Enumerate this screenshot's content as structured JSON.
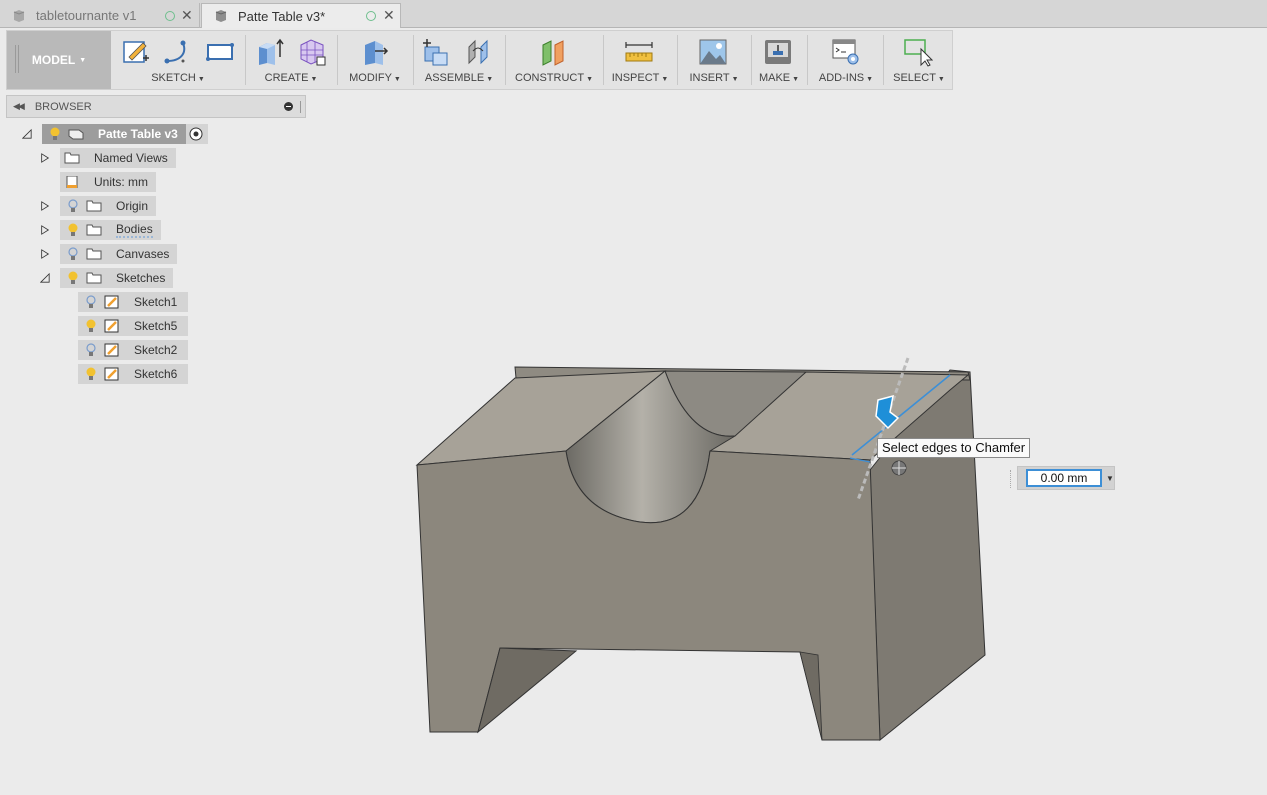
{
  "tabs": [
    {
      "label": "tabletournante v1",
      "active": false
    },
    {
      "label": "Patte Table v3*",
      "active": true
    }
  ],
  "toolbar": {
    "workspace": "MODEL",
    "groups": [
      {
        "label": "SKETCH"
      },
      {
        "label": "CREATE"
      },
      {
        "label": "MODIFY"
      },
      {
        "label": "ASSEMBLE"
      },
      {
        "label": "CONSTRUCT"
      },
      {
        "label": "INSPECT"
      },
      {
        "label": "INSERT"
      },
      {
        "label": "MAKE"
      },
      {
        "label": "ADD-INS"
      },
      {
        "label": "SELECT"
      }
    ]
  },
  "browser": {
    "title": "BROWSER",
    "root": "Patte Table v3",
    "items": [
      {
        "label": "Named Views"
      },
      {
        "label": "Units: mm"
      },
      {
        "label": "Origin"
      },
      {
        "label": "Bodies"
      },
      {
        "label": "Canvases"
      },
      {
        "label": "Sketches"
      },
      {
        "label": "Sketch1"
      },
      {
        "label": "Sketch5"
      },
      {
        "label": "Sketch2"
      },
      {
        "label": "Sketch6"
      }
    ]
  },
  "viewport": {
    "tooltip": "Select edges to Chamfer",
    "chamfer_distance": "0.00 mm"
  },
  "colors": {
    "accent": "#3d8fd6",
    "bulb_on": "#f2c230",
    "bulb_off": "#9ab6d6",
    "model_face": "#8a8478"
  }
}
